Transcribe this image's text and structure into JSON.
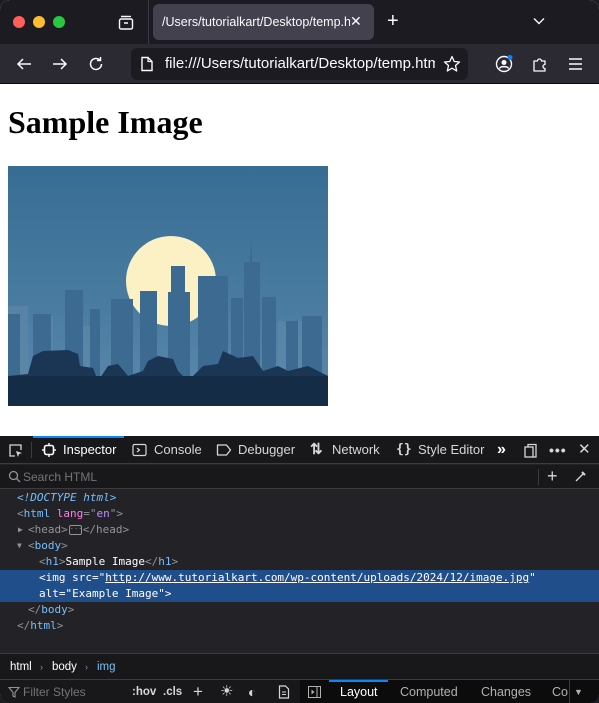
{
  "browser": {
    "traffic_lights": {
      "close": "#ff5f57",
      "minimize": "#febc2e",
      "zoom": "#28c840"
    },
    "tab": {
      "title": "/Users/tutorialkart/Desktop/temp.html",
      "close_icon": "close-icon"
    },
    "new_tab_icon": "plus-icon",
    "list_all_tabs_icon": "chevron-down-icon",
    "url": "file:///Users/tutorialkart/Desktop/temp.html"
  },
  "page": {
    "heading": "Sample Image",
    "image_alt": "Example Image",
    "image_colors": {
      "sky": "#3a6b8f",
      "moon": "#fbf1c4",
      "buildings": "#3d6a8f",
      "foreground": "#142c45"
    }
  },
  "devtools": {
    "tabs": [
      {
        "label": "Inspector",
        "selected": true
      },
      {
        "label": "Console"
      },
      {
        "label": "Debugger"
      },
      {
        "label": "Network"
      },
      {
        "label": "Style Editor"
      }
    ],
    "search_placeholder": "Search HTML",
    "markup": {
      "doctype": "<!DOCTYPE html>",
      "html_open": "html",
      "lang_attr": "lang",
      "lang_val": "en",
      "head": "head",
      "body": "body",
      "h1": "h1",
      "h1_text": "Sample Image",
      "img": "img",
      "src_attr": "src",
      "src_val": "http://www.tutorialkart.com/wp-content/uploads/2024/12/image.jpg",
      "alt_attr": "alt",
      "alt_val": "Example Image"
    },
    "breadcrumbs": [
      "html",
      "body",
      "img"
    ],
    "filter_placeholder": "Filter Styles",
    "hov": ":hov",
    "cls": ".cls",
    "side_tabs": [
      {
        "label": "Layout",
        "selected": true
      },
      {
        "label": "Computed"
      },
      {
        "label": "Changes"
      },
      {
        "label": "Co"
      }
    ],
    "accent": "#0a84ff"
  }
}
